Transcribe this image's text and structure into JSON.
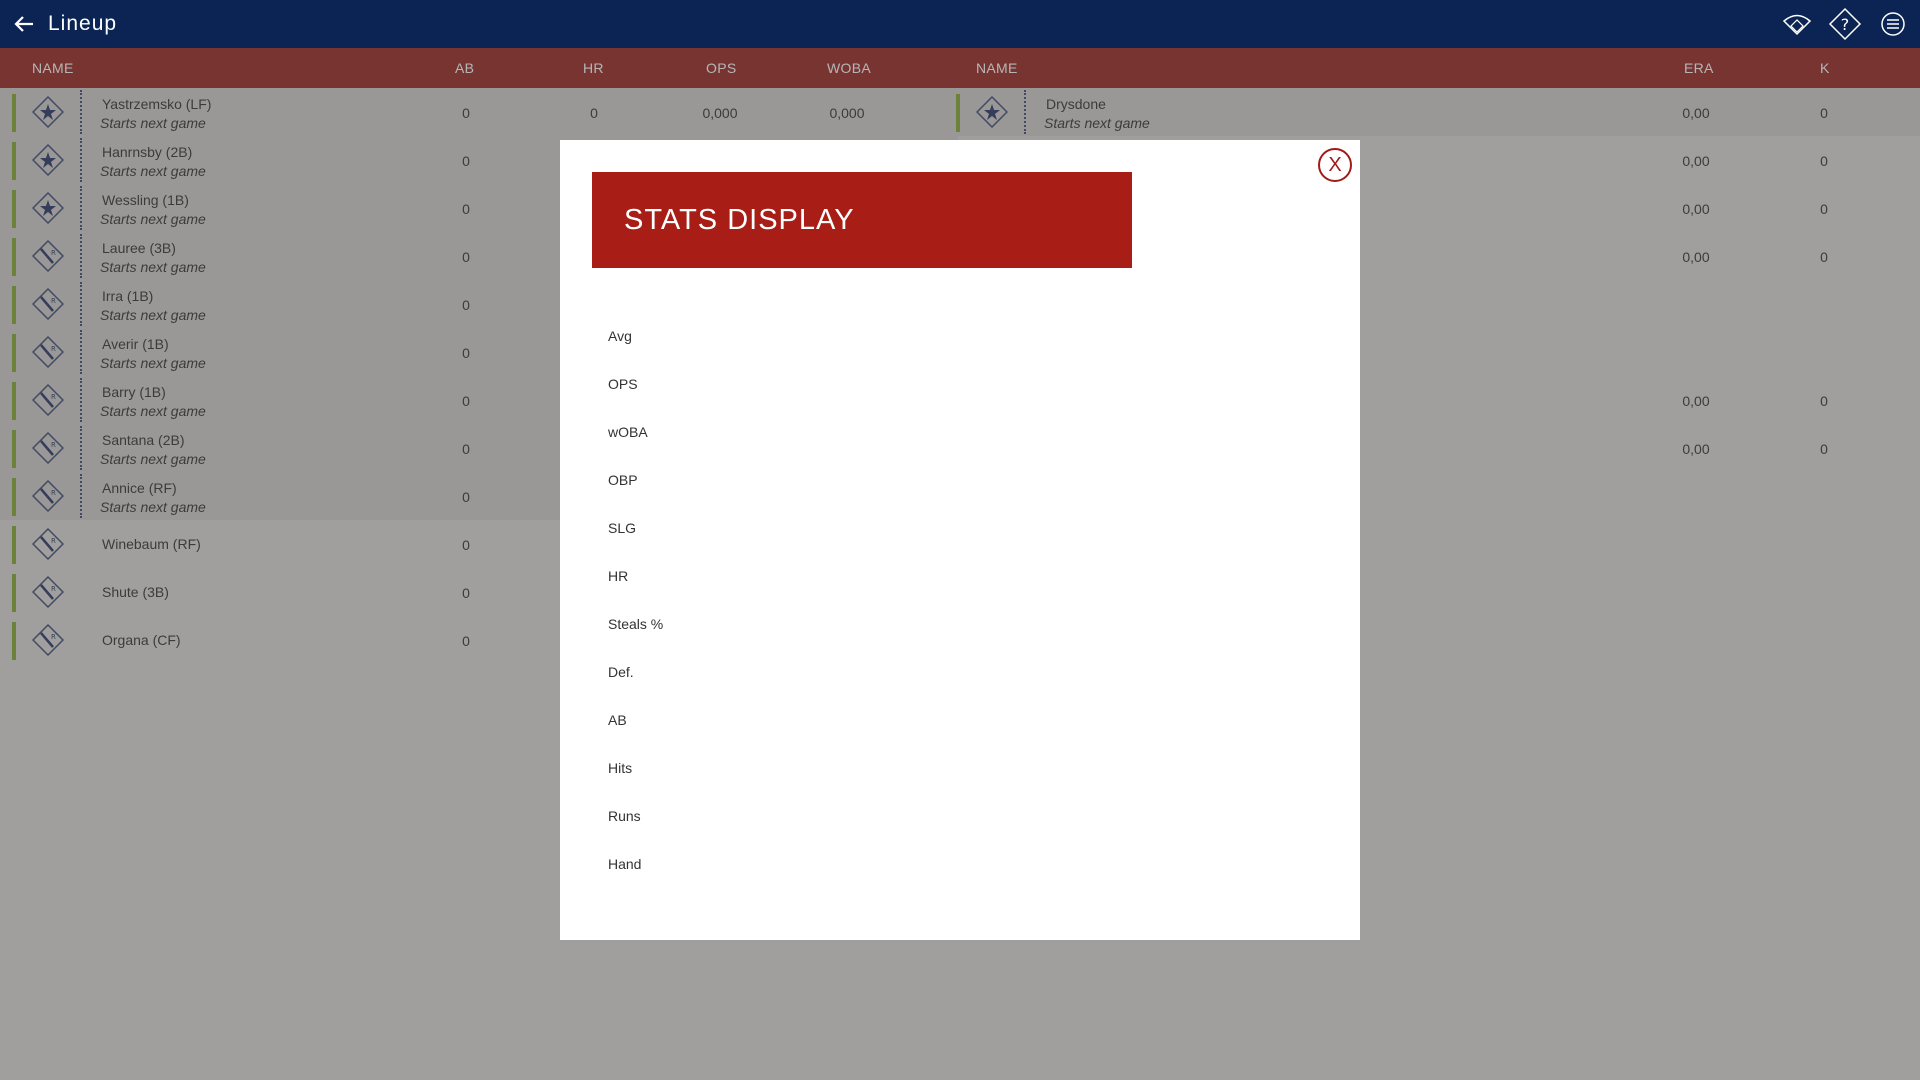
{
  "app": {
    "title": "Lineup"
  },
  "topbar_icons": [
    "field-icon",
    "help-icon",
    "menu-icon"
  ],
  "header": {
    "batting_columns": [
      "NAME",
      "AB",
      "HR",
      "OPS",
      "WOBA"
    ],
    "pitching_columns": [
      "NAME",
      "ERA",
      "K"
    ]
  },
  "batters": [
    {
      "name": "Yastrzemsko (LF)",
      "status": "Starts next game",
      "ab": "0",
      "hr": "0",
      "ops": "0,000",
      "woba": "0,000",
      "icon": "star"
    },
    {
      "name": "Hanrnsby (2B)",
      "status": "Starts next game",
      "ab": "0",
      "icon": "star"
    },
    {
      "name": "Wessling (1B)",
      "status": "Starts next game",
      "ab": "0",
      "icon": "star"
    },
    {
      "name": "Lauree (3B)",
      "status": "Starts next game",
      "ab": "0",
      "icon": "bat-r"
    },
    {
      "name": "Irra (1B)",
      "status": "Starts next game",
      "ab": "0",
      "icon": "bat-r"
    },
    {
      "name": "Averir (1B)",
      "status": "Starts next game",
      "ab": "0",
      "icon": "bat-r"
    },
    {
      "name": "Barry (1B)",
      "status": "Starts next game",
      "ab": "0",
      "icon": "bat-r"
    },
    {
      "name": "Santana (2B)",
      "status": "Starts next game",
      "ab": "0",
      "icon": "bat-r"
    },
    {
      "name": "Annice (RF)",
      "status": "Starts next game",
      "ab": "0",
      "icon": "bat-r"
    },
    {
      "name": "Winebaum (RF)",
      "status": "",
      "ab": "0",
      "icon": "bat-r"
    },
    {
      "name": "Shute (3B)",
      "status": "",
      "ab": "0",
      "icon": "bat-r"
    },
    {
      "name": "Organa (CF)",
      "status": "",
      "ab": "0",
      "icon": "bat-r"
    }
  ],
  "pitchers": [
    {
      "name": "Drysdone",
      "status": "Starts next game",
      "era": "0,00",
      "k": "0",
      "row": 0
    },
    {
      "era": "0,00",
      "k": "0",
      "row": 1
    },
    {
      "era": "0,00",
      "k": "0",
      "row": 2
    },
    {
      "era": "0,00",
      "k": "0",
      "row": 3
    },
    {
      "era": "0,00",
      "k": "0",
      "row": 6
    },
    {
      "era": "0,00",
      "k": "0",
      "row": 7
    }
  ],
  "modal": {
    "title": "STATS DISPLAY",
    "close_label": "X",
    "options": [
      "Avg",
      "OPS",
      "wOBA",
      "OBP",
      "SLG",
      "HR",
      "Steals %",
      "Def.",
      "AB",
      "Hits",
      "Runs",
      "Hand"
    ]
  },
  "colors": {
    "topbar": "#0b2453",
    "header": "#8f1410",
    "modal_title_bg": "#a81d16",
    "status_bar": "#7aa21f"
  }
}
